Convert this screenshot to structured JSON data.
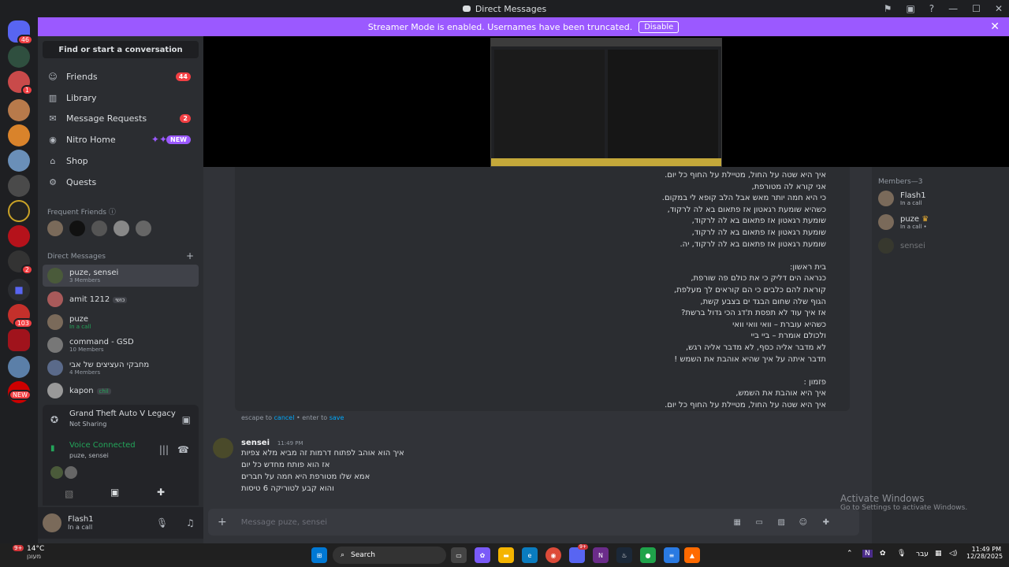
{
  "window": {
    "title": "Direct Messages"
  },
  "banner": {
    "text": "Streamer Mode is enabled. Usernames have been truncated.",
    "button": "Disable"
  },
  "servers": {
    "home_badge": "46",
    "badge_1": "1",
    "badge_2": "2",
    "badge_103": "103",
    "new_label": "NEW"
  },
  "sidebar": {
    "search": "Find or start a conversation",
    "nav": [
      {
        "label": "Friends",
        "badge": "44"
      },
      {
        "label": "Library",
        "badge": ""
      },
      {
        "label": "Message Requests",
        "badge": "2"
      },
      {
        "label": "Nitro Home",
        "badge": "NEW"
      },
      {
        "label": "Shop",
        "badge": ""
      },
      {
        "label": "Quests",
        "badge": ""
      }
    ],
    "frequent_friends_label": "Frequent Friends",
    "direct_messages_label": "Direct Messages",
    "dms": [
      {
        "name": "puze, sensei",
        "sub": "3 Members",
        "tag": ""
      },
      {
        "name": "amit 1212",
        "sub": "",
        "tag": "כושי"
      },
      {
        "name": "puze",
        "sub": "In a call",
        "tag": ""
      },
      {
        "name": "command - GSD",
        "sub": "10 Members",
        "tag": ""
      },
      {
        "name": "מחבקי העציצים של אבי",
        "sub": "4 Members",
        "tag": ""
      },
      {
        "name": "kapon",
        "sub": "",
        "tag": "chil"
      }
    ],
    "activity": {
      "title": "Grand Theft Auto V Legacy",
      "sub": "Not Sharing"
    },
    "voice": {
      "status": "Voice Connected",
      "channel": "puze, sensei"
    },
    "user": {
      "name": "Flash1",
      "status": "In a call"
    }
  },
  "editor": {
    "lyrics": [
      "איך היא שטה על החול, מטיילת על החוף כל יום.",
      "אני קורא לה מטורפת,",
      "כי היא חמה יותר מאש אבל הלב קופא לי במקום.",
      "כשהיא שומעת רגאטון אז פתאום בא לה לרקוד,",
      "שומעת רגאטון אז פתאום בא לה לרקוד,",
      "שומעת רגאטון אז פתאום בא לה לרקוד,",
      "שומעת רגאטון אז פתאום בא לה לרקוד, יה.",
      "",
      "בית ראשון:",
      "כנראה הים דליק כי את כולם פה שורפת,",
      "קוראת להם כלבים כי הם קוראים לך מעלפת,",
      "הגוף שלה שחום הבגד ים בצבע קשת,",
      "אז איך עוד לא תפסת ת'דג הכי גדול ברשת?",
      "כשהיא עוברת – וואי וואי וואי",
      "ולכולם אומרת – ביי ביי",
      "לא מדבר אליה כסף, לא מדבר אליה רגש,",
      "תדבר איתה על איך שהיא אוהבת את השמש !",
      "",
      "פזמון :",
      "איך היא אוהבת את השמש,",
      "איך היא שטה על החול, מטיילת על החוף כל יום."
    ],
    "hint_prefix": "escape to ",
    "hint_cancel": "cancel",
    "hint_mid": " • enter to ",
    "hint_save": "save"
  },
  "message": {
    "author": "sensei",
    "time": "11:49 PM",
    "lines": [
      "איך הוא אוהב לפתוח דרמות זה מביא מלא צפיות",
      "אז הוא פותח מחדש כל יום",
      "אמא שלו מטורפת היא חמה על חברים",
      "והוא קבע לטוריקה 6 טיסות"
    ]
  },
  "input": {
    "placeholder": "Message puze, sensei"
  },
  "members": {
    "header": "Members—3",
    "list": [
      {
        "name": "Flash1",
        "sub": "In a call"
      },
      {
        "name": "puze",
        "sub": "In a call •"
      },
      {
        "name": "sensei",
        "sub": ""
      }
    ]
  },
  "watermark": {
    "title": "Activate Windows",
    "sub": "Go to Settings to activate Windows."
  },
  "taskbar": {
    "weather_temp": "14°C",
    "weather_label": "מעונן",
    "weather_badge": "9+",
    "search": "Search",
    "lang": "עבר",
    "time": "11:49 PM",
    "date": "12/28/2025",
    "discord_badge": "9+"
  }
}
